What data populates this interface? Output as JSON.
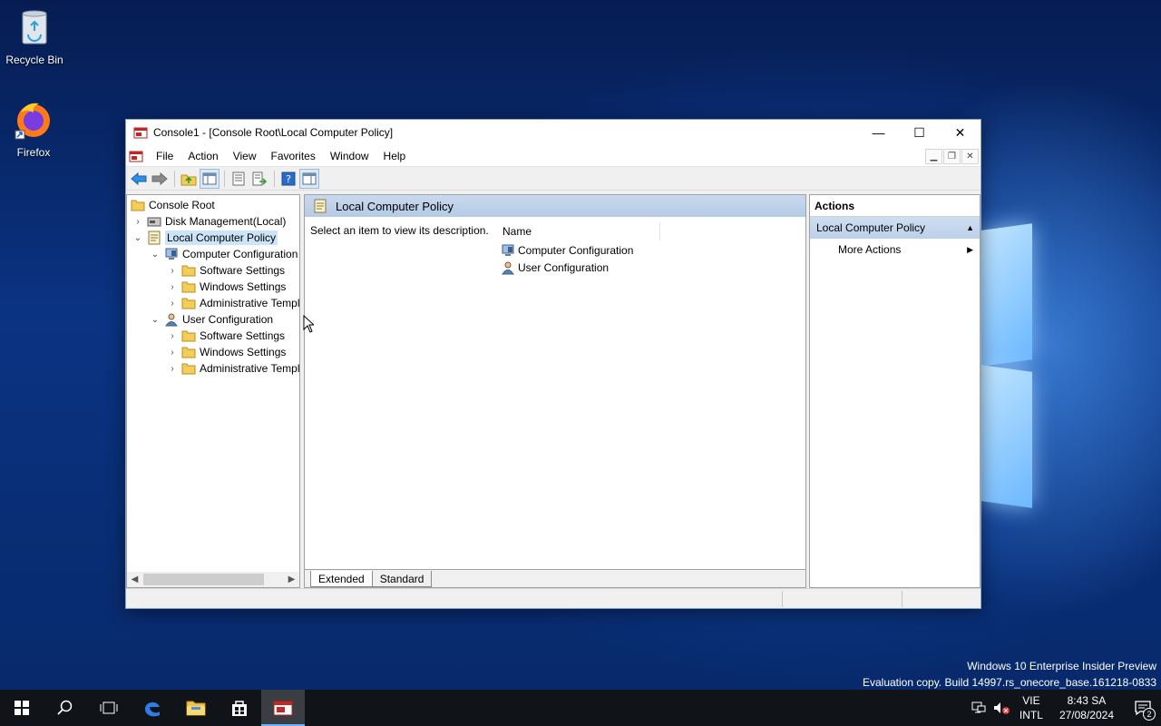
{
  "desktop": {
    "icons": [
      {
        "label": "Recycle Bin",
        "icon": "recycle-bin-icon"
      },
      {
        "label": "Firefox",
        "icon": "firefox-icon"
      }
    ],
    "watermark_line1": "Windows 10 Enterprise Insider Preview",
    "watermark_line2": "Evaluation copy. Build 14997.rs_onecore_base.161218-0833"
  },
  "window": {
    "title": "Console1 - [Console Root\\Local Computer Policy]",
    "controls": {
      "minimize": "—",
      "maximize": "☐",
      "close": "✕"
    }
  },
  "menubar": {
    "items": [
      "File",
      "Action",
      "View",
      "Favorites",
      "Window",
      "Help"
    ]
  },
  "tree": {
    "rows": [
      {
        "label": "Console Root",
        "level": 0,
        "chevron": "",
        "icon": "folder-icon"
      },
      {
        "label": "Disk Management(Local)",
        "level": 1,
        "chevron": "›",
        "icon": "disk-management-icon"
      },
      {
        "label": "Local Computer Policy",
        "level": 1,
        "chevron": "⌄",
        "icon": "policy-icon",
        "selected": true
      },
      {
        "label": "Computer Configuration",
        "level": 2,
        "chevron": "⌄",
        "icon": "computer-configuration-icon"
      },
      {
        "label": "Software Settings",
        "level": 3,
        "chevron": "›",
        "icon": "folder-icon"
      },
      {
        "label": "Windows Settings",
        "level": 3,
        "chevron": "›",
        "icon": "folder-icon"
      },
      {
        "label": "Administrative Templates",
        "level": 3,
        "chevron": "›",
        "icon": "folder-icon"
      },
      {
        "label": "User Configuration",
        "level": 2,
        "chevron": "⌄",
        "icon": "user-configuration-icon"
      },
      {
        "label": "Software Settings",
        "level": 3,
        "chevron": "›",
        "icon": "folder-icon"
      },
      {
        "label": "Windows Settings",
        "level": 3,
        "chevron": "›",
        "icon": "folder-icon"
      },
      {
        "label": "Administrative Templates",
        "level": 3,
        "chevron": "›",
        "icon": "folder-icon"
      }
    ]
  },
  "center": {
    "header": "Local Computer Policy",
    "description": "Select an item to view its description.",
    "column_name": "Name",
    "items": [
      {
        "label": "Computer Configuration",
        "icon": "computer-configuration-icon"
      },
      {
        "label": "User Configuration",
        "icon": "user-configuration-icon"
      }
    ],
    "tabs": [
      {
        "label": "Extended",
        "active": true
      },
      {
        "label": "Standard",
        "active": false
      }
    ]
  },
  "actions": {
    "title": "Actions",
    "section": "Local Computer Policy",
    "items": [
      "More Actions"
    ]
  },
  "taskbar": {
    "lang_line1": "VIE",
    "lang_line2": "INTL",
    "time": "8:43 SA",
    "date": "27/08/2024",
    "notification_count": "2"
  },
  "colors": {
    "accent": "#0078d7",
    "selection": "#cce4f7",
    "header_blue": "#b5cae6",
    "taskbar": "#101317"
  }
}
